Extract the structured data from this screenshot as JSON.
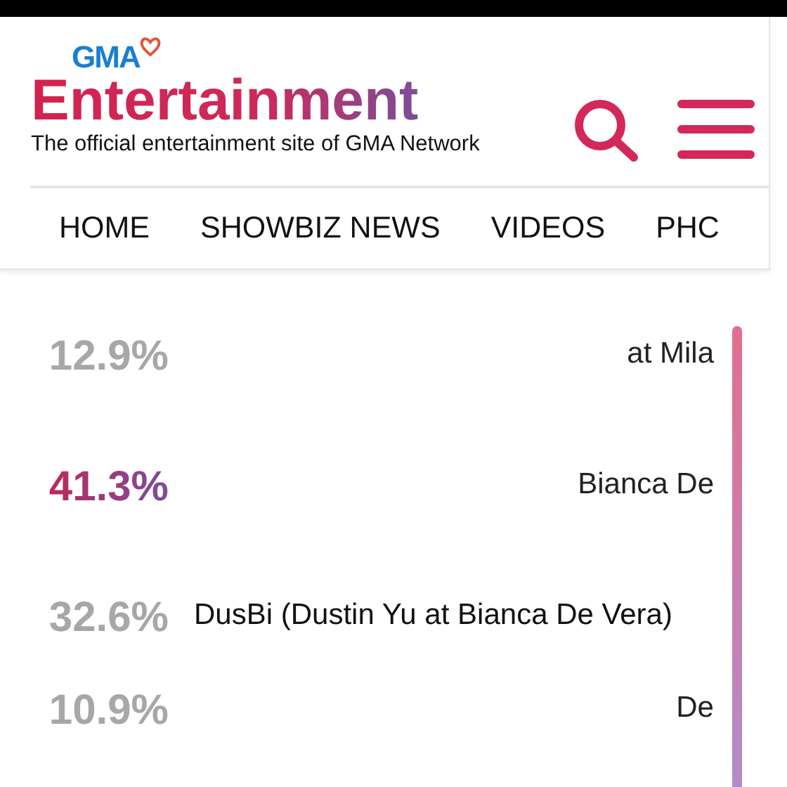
{
  "logo": {
    "network": "GMA",
    "title": "Entertainment",
    "tagline": "The official entertainment site of GMA Network"
  },
  "nav": [
    {
      "label": "HOME"
    },
    {
      "label": "SHOWBIZ NEWS"
    },
    {
      "label": "VIDEOS"
    },
    {
      "label": "PHC"
    }
  ],
  "results": [
    {
      "percent": "12.9%",
      "name": "at Mila",
      "leading": false,
      "obscured": true
    },
    {
      "percent": "41.3%",
      "name": "Bianca De",
      "leading": true,
      "obscured": true
    },
    {
      "percent": "32.6%",
      "name": "DusBi (Dustin Yu at Bianca De Vera)",
      "leading": false,
      "obscured": false
    },
    {
      "percent": "10.9%",
      "name": "De",
      "leading": false,
      "obscured": true
    }
  ]
}
